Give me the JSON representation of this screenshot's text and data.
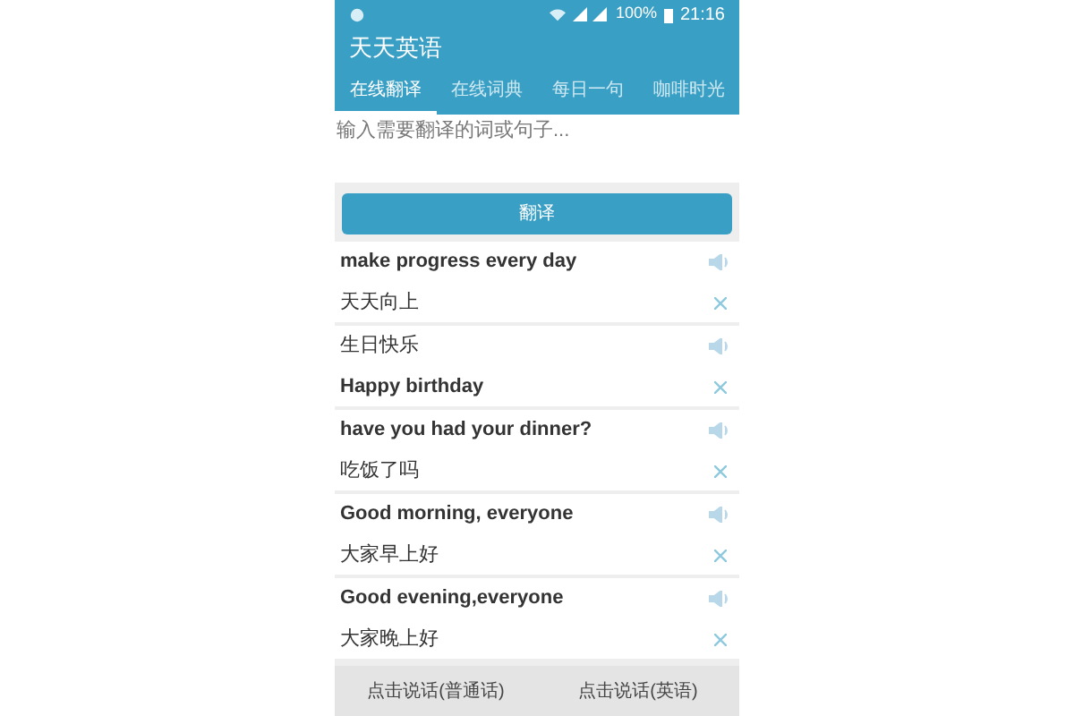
{
  "status_bar": {
    "battery": "100%",
    "time": "21:16"
  },
  "app_bar": {
    "title": "天天英语"
  },
  "tabs": [
    {
      "label": "在线翻译",
      "selected": true
    },
    {
      "label": "在线词典",
      "selected": false
    },
    {
      "label": "每日一句",
      "selected": false
    },
    {
      "label": "咖啡时光",
      "selected": false
    }
  ],
  "input": {
    "placeholder": "输入需要翻译的词或句子..."
  },
  "translate_button": "翻译",
  "entries": [
    {
      "lines": [
        {
          "kind": "en",
          "text": "make progress every day"
        },
        {
          "kind": "zh",
          "text": "天天向上"
        }
      ]
    },
    {
      "lines": [
        {
          "kind": "zh",
          "text": "生日快乐"
        },
        {
          "kind": "en",
          "text": "Happy birthday"
        }
      ]
    },
    {
      "lines": [
        {
          "kind": "en",
          "text": "have you had your dinner?"
        },
        {
          "kind": "zh",
          "text": "吃饭了吗"
        }
      ]
    },
    {
      "lines": [
        {
          "kind": "en",
          "text": "Good morning, everyone"
        },
        {
          "kind": "zh",
          "text": "大家早上好"
        }
      ]
    },
    {
      "lines": [
        {
          "kind": "en",
          "text": "Good evening,everyone"
        },
        {
          "kind": "zh",
          "text": "大家晚上好"
        }
      ]
    }
  ],
  "bottom_buttons": [
    "点击说话(普通话)",
    "点击说话(英语)"
  ]
}
